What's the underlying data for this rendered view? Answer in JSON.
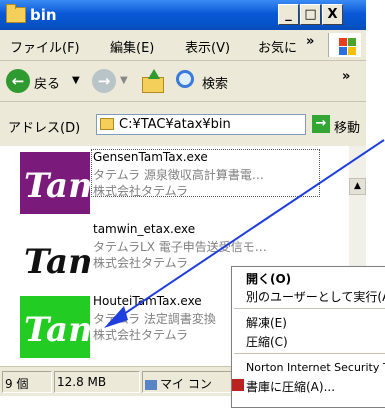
{
  "window": {
    "title": "bin",
    "buttons": {
      "minimize": "_",
      "maximize": "□",
      "close": "X"
    }
  },
  "menubar": {
    "items": [
      "ファイル(F)",
      "編集(E)",
      "表示(V)",
      "お気に"
    ],
    "overflow": "»"
  },
  "toolbar": {
    "back_label": "戻る",
    "search_label": "検索",
    "overflow": "»"
  },
  "addressbar": {
    "label": "アドレス(D)",
    "path": "C:¥TAC¥atax¥bin",
    "go_label": "移動"
  },
  "files": [
    {
      "name": "GensenTamTax.exe",
      "desc": "タテムラ 源泉徴収高計算書電…",
      "company": "株式会社タテムラ"
    },
    {
      "name": "tamwin_etax.exe",
      "desc": "タテムラLX 電子申告送受信モ…",
      "company": "株式会社タテムラ"
    },
    {
      "name": "HouteiTamTax.exe",
      "desc": "タテムラ 法定調書変換",
      "company": "株式会社タテムラ"
    }
  ],
  "thumb_text": "Tam",
  "statusbar": {
    "count": "9 個",
    "size": "12.8 MB",
    "location": "マイ コン"
  },
  "context_menu": {
    "items": [
      "開く(O)",
      "別のユーザーとして実行(A",
      "解凍(E)",
      "圧縮(C)",
      "Norton Internet Security T",
      "書庫に圧縮(A)..."
    ]
  },
  "colors": {
    "titlebar": "#0a58d8",
    "arrow": "#1f3ee0",
    "thumb_green": "#22cc22",
    "thumb_purple": "#7a1a7a"
  }
}
